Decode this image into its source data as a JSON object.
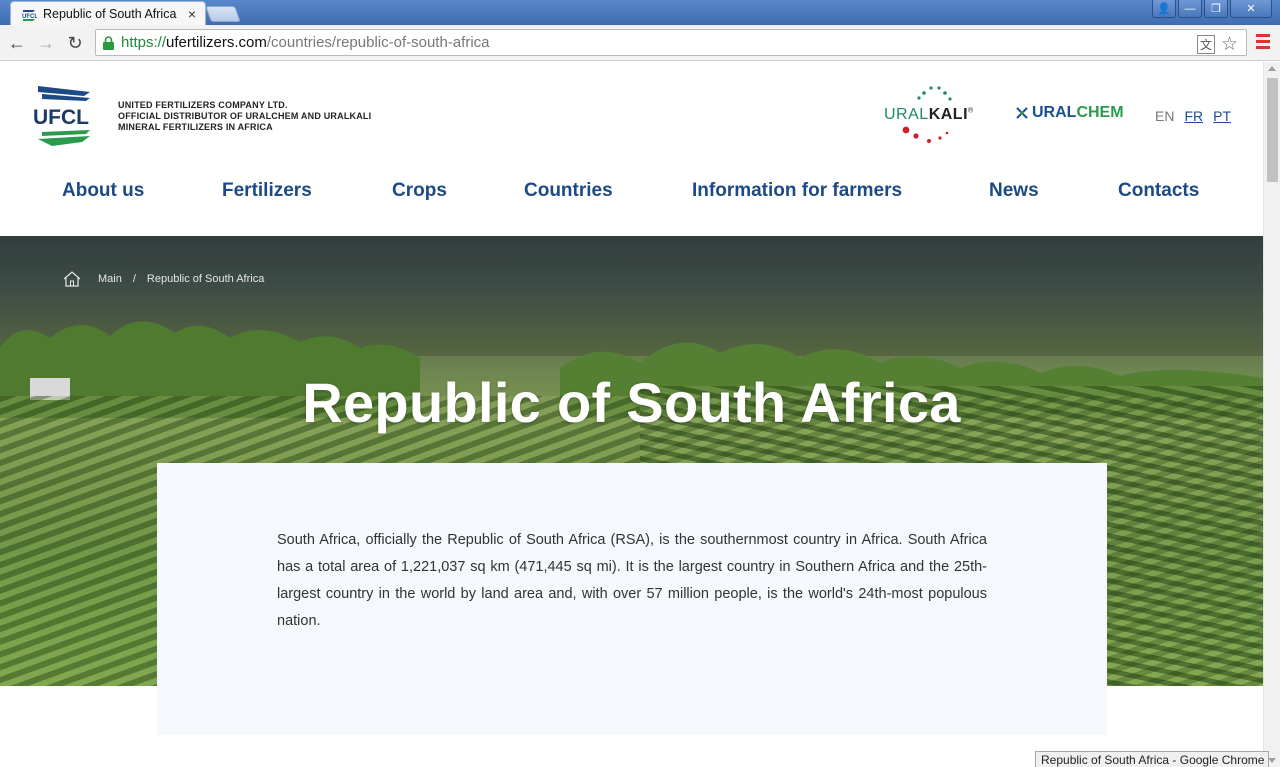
{
  "browser": {
    "tab_title": "Republic of South Africa",
    "tab_close": "×",
    "url_scheme": "https://",
    "url_host": "ufertilizers.com",
    "url_path": "/countries/republic-of-south-africa",
    "status_tip": "Republic of South Africa - Google Chrome",
    "window_buttons": {
      "user": "👤",
      "minimize": "—",
      "restore": "❐",
      "close": "✕"
    },
    "nav": {
      "back": "←",
      "forward": "→",
      "reload": "↻"
    },
    "omni_icons": {
      "translate": "文",
      "star": "☆"
    }
  },
  "header": {
    "logo_text": "UFCL",
    "company_lines": [
      "UNITED FERTILIZERS COMPANY LTD.",
      "OFFICIAL DISTRIBUTOR OF URALCHEM AND URALKALI",
      "MINERAL FERTILIZERS IN AFRICA"
    ],
    "uralkali": {
      "ural": "URAL",
      "kali": "KALI",
      "reg": "®"
    },
    "uralchem": {
      "part1": "URAL",
      "part2": "CHEM"
    },
    "languages": [
      "EN",
      "FR",
      "PT"
    ],
    "active_language": "EN"
  },
  "nav": {
    "items": [
      "About us",
      "Fertilizers",
      "Crops",
      "Countries",
      "Information for farmers",
      "News",
      "Contacts"
    ]
  },
  "breadcrumb": {
    "items": [
      "Main",
      "Republic of South Africa"
    ],
    "separator": "/"
  },
  "hero": {
    "title": "Republic of South Africa"
  },
  "content": {
    "paragraph": "South Africa, officially the Republic of South Africa (RSA), is the southernmost country in Africa. South Africa has a total area of 1,221,037 sq km (471,445 sq mi). It is the largest country in Southern Africa and the 25th-largest country in the world by land area and, with over 57 million people, is the world's 24th-most populous nation."
  },
  "colors": {
    "nav_blue": "#1c4a86",
    "uralkali_green": "#1f8a6a",
    "uralkali_red": "#d0202e",
    "uralchem_blue": "#1a4f8f",
    "uralchem_green": "#2a9a4e",
    "card_bg": "#f5f8fc"
  }
}
